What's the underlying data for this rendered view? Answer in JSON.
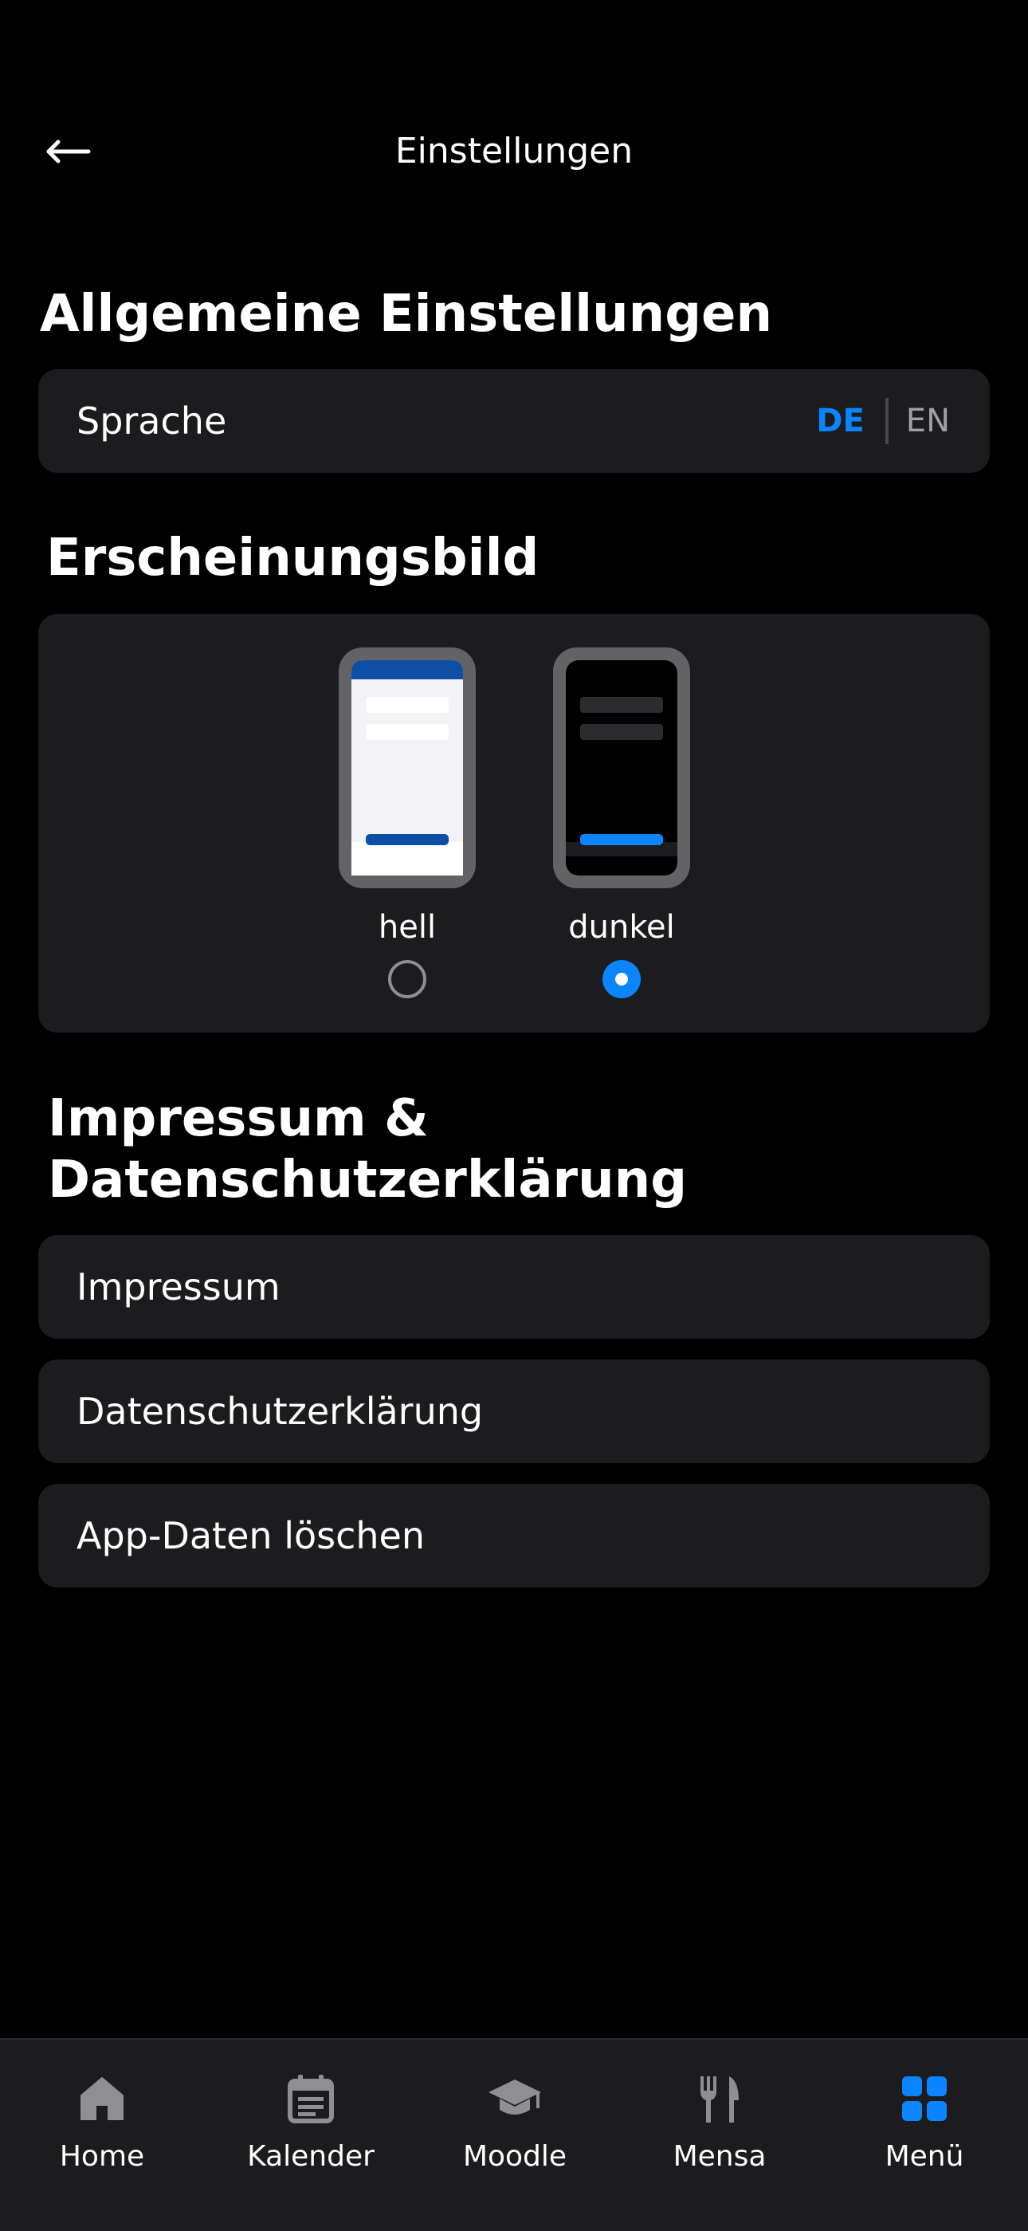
{
  "header": {
    "title": "Einstellungen"
  },
  "general": {
    "title": "Allgemeine Einstellungen",
    "language_label": "Sprache",
    "lang_options": [
      "DE",
      "EN"
    ],
    "selected_language": "DE"
  },
  "appearance": {
    "title": "Erscheinungsbild",
    "options": [
      {
        "label": "hell",
        "selected": false
      },
      {
        "label": "dunkel",
        "selected": true
      }
    ]
  },
  "legal": {
    "title_line1": "Impressum &",
    "title_line2": "Datenschutzerklärung",
    "items": [
      "Impressum",
      "Datenschutzerklärung",
      "App-Daten löschen"
    ]
  },
  "nav": {
    "items": [
      {
        "label": "Home",
        "icon": "home-icon"
      },
      {
        "label": "Kalender",
        "icon": "calendar-icon"
      },
      {
        "label": "Moodle",
        "icon": "graduation-cap-icon"
      },
      {
        "label": "Mensa",
        "icon": "cutlery-icon"
      },
      {
        "label": "Menü",
        "icon": "grid-icon",
        "active": true
      }
    ]
  },
  "colors": {
    "accent": "#0a84ff",
    "background": "#000000",
    "card": "#1c1c1e",
    "inactive_icon": "#8e8e93",
    "light_theme_bar": "#0d4fa6"
  }
}
